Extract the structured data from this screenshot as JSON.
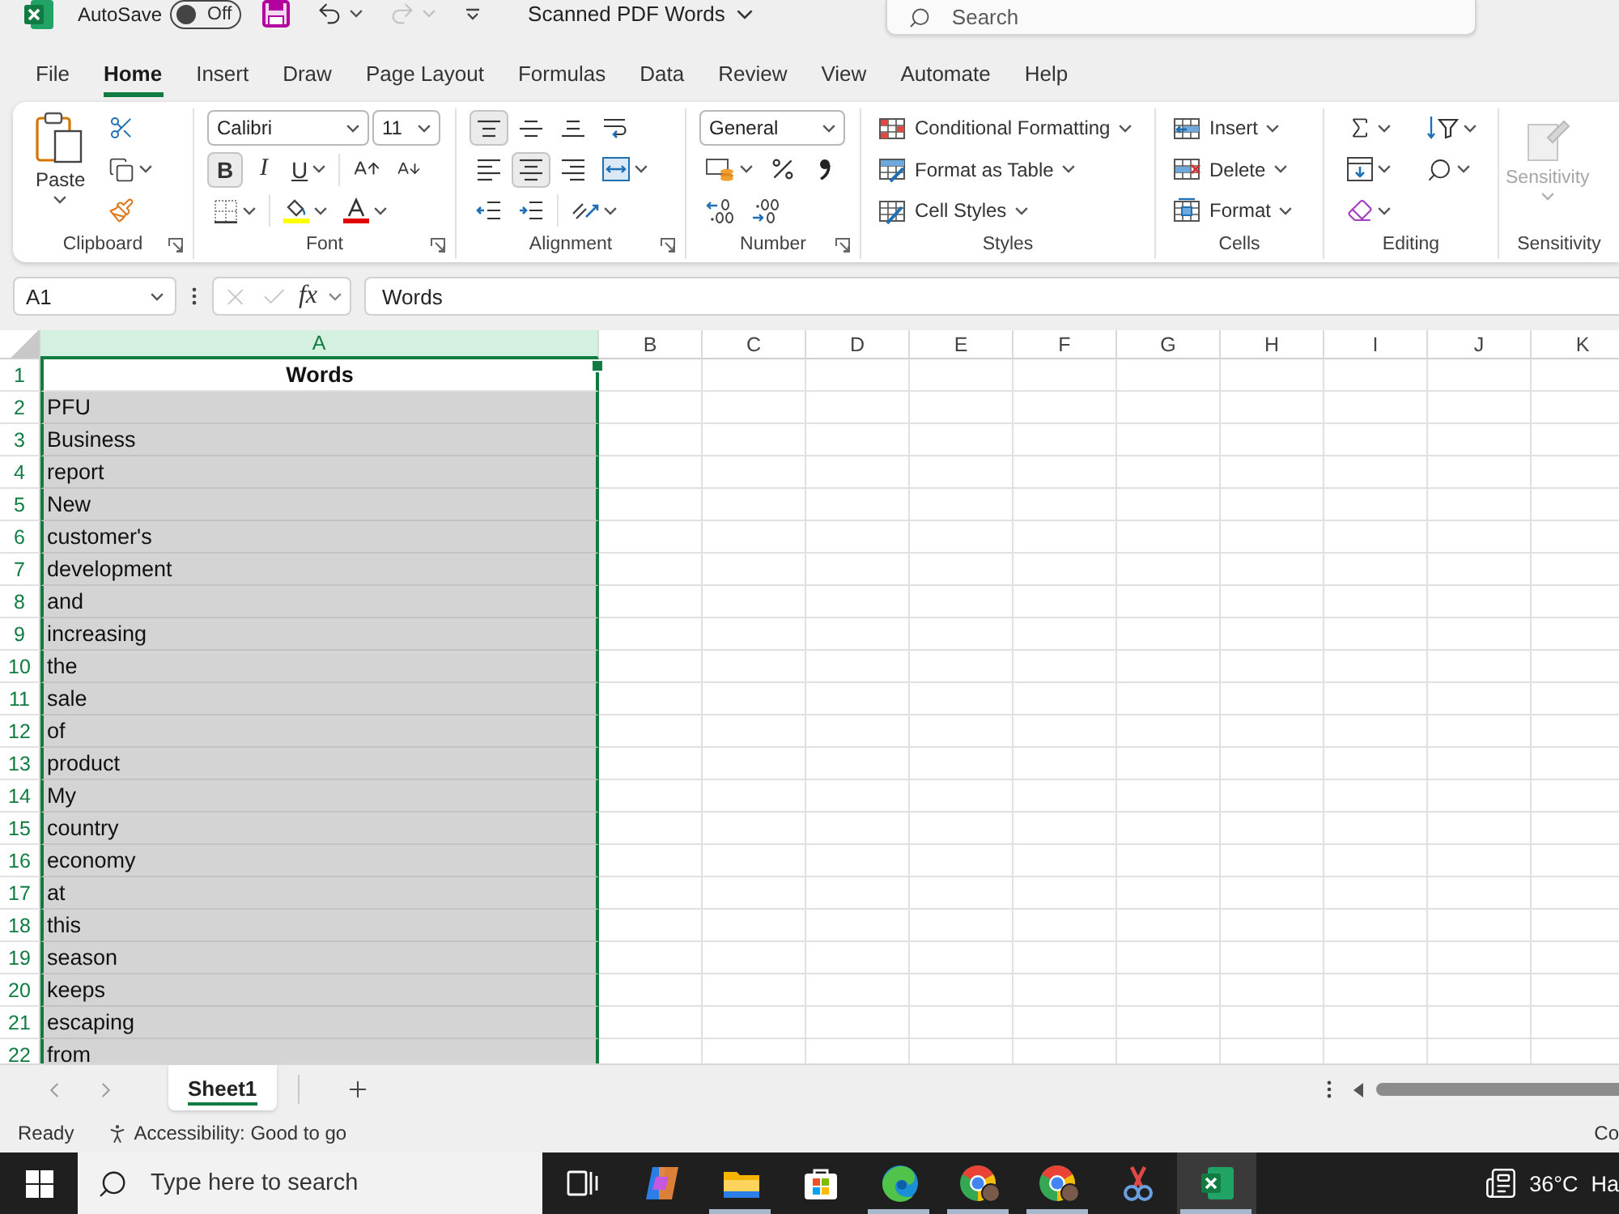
{
  "title_bar": {
    "autosave_label": "AutoSave",
    "autosave": {
      "on": false,
      "label": "Off"
    },
    "redo": {
      "disabled": true
    },
    "document_title": "Scanned PDF Words",
    "search": {
      "placeholder": "Search"
    }
  },
  "ribbon_tabs": [
    {
      "label": "File",
      "selected": false
    },
    {
      "label": "Home",
      "selected": true
    },
    {
      "label": "Insert",
      "selected": false
    },
    {
      "label": "Draw",
      "selected": false
    },
    {
      "label": "Page Layout",
      "selected": false
    },
    {
      "label": "Formulas",
      "selected": false
    },
    {
      "label": "Data",
      "selected": false
    },
    {
      "label": "Review",
      "selected": false
    },
    {
      "label": "View",
      "selected": false
    },
    {
      "label": "Automate",
      "selected": false
    },
    {
      "label": "Help",
      "selected": false
    }
  ],
  "ribbon": {
    "clipboard": {
      "paste": "Paste",
      "label": "Clipboard"
    },
    "font": {
      "font_name": "Calibri",
      "font_size": "11",
      "bold": {
        "label": "B",
        "selected": true
      },
      "italic": {
        "label": "I",
        "selected": false
      },
      "underline": {
        "label": "U",
        "selected": false
      },
      "label": "Font"
    },
    "alignment": {
      "vertical": [
        {
          "kind": "top",
          "selected": true
        },
        {
          "kind": "middle",
          "selected": false
        },
        {
          "kind": "bottom",
          "selected": false
        }
      ],
      "horizontal": [
        {
          "kind": "left",
          "selected": false
        },
        {
          "kind": "center",
          "selected": true
        },
        {
          "kind": "right",
          "selected": false
        }
      ],
      "label": "Alignment"
    },
    "number": {
      "format": "General",
      "label": "Number"
    },
    "styles": {
      "items": [
        {
          "kind": "conditional",
          "label": "Conditional Formatting"
        },
        {
          "kind": "table",
          "label": "Format as Table"
        },
        {
          "kind": "cell_styles",
          "label": "Cell Styles"
        }
      ],
      "label": "Styles"
    },
    "cells": {
      "items": [
        {
          "kind": "insert",
          "label": "Insert"
        },
        {
          "kind": "delete",
          "label": "Delete"
        },
        {
          "kind": "format",
          "label": "Format"
        }
      ],
      "label": "Cells"
    },
    "editing": {
      "label": "Editing"
    },
    "sensitivity": {
      "button": {
        "label": "Sensitivity",
        "disabled": true
      },
      "label": "Sensitivity"
    }
  },
  "formula_bar": {
    "name_box": "A1",
    "cancel": {
      "disabled": true
    },
    "enter": {
      "disabled": true
    },
    "function_label": "fx",
    "formula": "Words"
  },
  "sheet": {
    "columns": [
      {
        "label": "A",
        "selected": true
      },
      {
        "label": "B",
        "selected": false
      },
      {
        "label": "C",
        "selected": false
      },
      {
        "label": "D",
        "selected": false
      },
      {
        "label": "E",
        "selected": false
      },
      {
        "label": "F",
        "selected": false
      },
      {
        "label": "G",
        "selected": false
      },
      {
        "label": "H",
        "selected": false
      },
      {
        "label": "I",
        "selected": false
      },
      {
        "label": "J",
        "selected": false
      },
      {
        "label": "K",
        "selected": false
      }
    ],
    "rows": [
      {
        "number": "1",
        "value": "Words",
        "kind": "header",
        "active": true
      },
      {
        "number": "2",
        "value": "PFU",
        "kind": "text",
        "active": false
      },
      {
        "number": "3",
        "value": "Business",
        "kind": "text",
        "active": false
      },
      {
        "number": "4",
        "value": "report",
        "kind": "text",
        "active": false
      },
      {
        "number": "5",
        "value": "New",
        "kind": "text",
        "active": false
      },
      {
        "number": "6",
        "value": "customer's",
        "kind": "text",
        "active": false
      },
      {
        "number": "7",
        "value": "development",
        "kind": "text",
        "active": false
      },
      {
        "number": "8",
        "value": "and",
        "kind": "text",
        "active": false
      },
      {
        "number": "9",
        "value": "increasing",
        "kind": "text",
        "active": false
      },
      {
        "number": "10",
        "value": "the",
        "kind": "text",
        "active": false
      },
      {
        "number": "11",
        "value": "sale",
        "kind": "text",
        "active": false
      },
      {
        "number": "12",
        "value": "of",
        "kind": "text",
        "active": false
      },
      {
        "number": "13",
        "value": "product",
        "kind": "text",
        "active": false
      },
      {
        "number": "14",
        "value": "My",
        "kind": "text",
        "active": false
      },
      {
        "number": "15",
        "value": "country",
        "kind": "text",
        "active": false
      },
      {
        "number": "16",
        "value": "economy",
        "kind": "text",
        "active": false
      },
      {
        "number": "17",
        "value": "at",
        "kind": "text",
        "active": false
      },
      {
        "number": "18",
        "value": "this",
        "kind": "text",
        "active": false
      },
      {
        "number": "19",
        "value": "season",
        "kind": "text",
        "active": false
      },
      {
        "number": "20",
        "value": "keeps",
        "kind": "text",
        "active": false
      },
      {
        "number": "21",
        "value": "escaping",
        "kind": "text",
        "active": false
      },
      {
        "number": "22",
        "value": "from",
        "kind": "text",
        "active": false
      }
    ]
  },
  "sheet_tabs": [
    {
      "label": "Sheet1",
      "selected": true
    }
  ],
  "status_bar": {
    "mode": "Ready",
    "accessibility": "Accessibility: Good to go",
    "right_text": "Co"
  },
  "taskbar": {
    "search": {
      "placeholder": "Type here to search"
    },
    "apps": [
      {
        "kind": "taskview",
        "running": false,
        "active": false
      },
      {
        "kind": "copilot",
        "running": false,
        "active": false
      },
      {
        "kind": "explorer",
        "running": true,
        "active": false
      },
      {
        "kind": "store",
        "running": false,
        "active": false
      },
      {
        "kind": "edge",
        "running": true,
        "active": false
      },
      {
        "kind": "chrome",
        "running": true,
        "active": false
      },
      {
        "kind": "chrome",
        "running": true,
        "active": false
      },
      {
        "kind": "snipping",
        "running": false,
        "active": false
      },
      {
        "kind": "excel",
        "running": true,
        "active": true
      }
    ],
    "weather": "36°C",
    "right_text": "Ha"
  }
}
